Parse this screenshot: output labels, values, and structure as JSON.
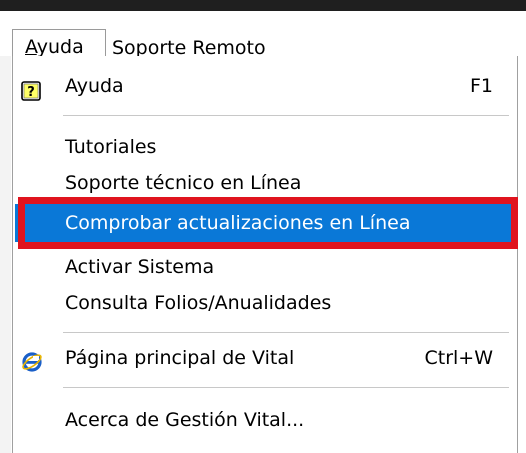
{
  "menubar": {
    "items": [
      {
        "label_mnemonic": "A",
        "label_rest": "yuda"
      },
      {
        "label": "Soporte Remoto"
      }
    ]
  },
  "menu": {
    "items": [
      {
        "label": "Ayuda",
        "shortcut": "F1",
        "icon": "help-question-icon"
      },
      {
        "label": "Tutoriales"
      },
      {
        "label": "Soporte técnico en Línea"
      },
      {
        "label": "Comprobar actualizaciones en Línea",
        "highlighted": true
      },
      {
        "label": "Activar Sistema"
      },
      {
        "label": "Consulta Folios/Anualidades"
      },
      {
        "label": "Página principal de Vital",
        "shortcut": "Ctrl+W",
        "icon": "internet-explorer-icon"
      },
      {
        "label": "Acerca de Gestión Vital..."
      }
    ]
  },
  "colors": {
    "highlight": "#0a78d7",
    "annotation": "#e0141e"
  }
}
